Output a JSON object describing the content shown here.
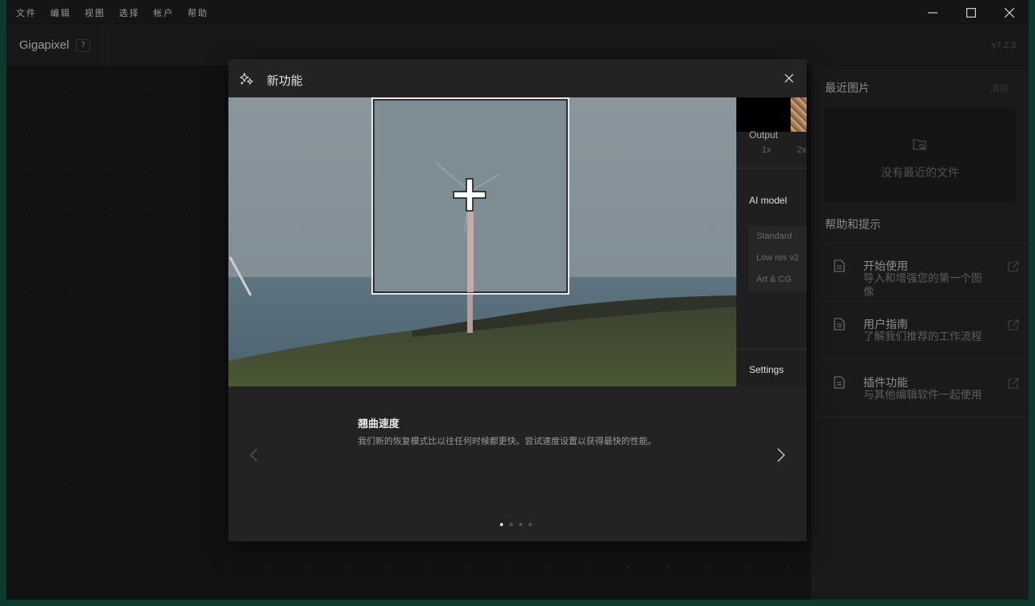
{
  "menubar": {
    "items": [
      "文件",
      "编辑",
      "视图",
      "选择",
      "帐户",
      "帮助"
    ]
  },
  "titlebar": {
    "app_name": "Gigapixel",
    "badge": "7",
    "version": "v7.2.3"
  },
  "right_panel": {
    "recent_heading": "最近图片",
    "clear_label": "清除",
    "recent_empty": "没有最近的文件",
    "help_heading": "帮助和提示",
    "help_items": [
      {
        "title": "开始使用",
        "desc": "导入和增强您的第一个图像"
      },
      {
        "title": "用户指南",
        "desc": "了解我们推荐的工作流程"
      },
      {
        "title": "插件功能",
        "desc": "与其他编辑软件一起使用"
      }
    ]
  },
  "modal": {
    "title": "新功能",
    "side": {
      "output_label": "Output",
      "output_options": [
        "1x",
        "2x"
      ],
      "ai_model_label": "AI model",
      "models": [
        "Standard",
        "Low res v2",
        "Art & CG"
      ],
      "settings_label": "Settings"
    },
    "feature_title": "翘曲速度",
    "feature_desc": "我们新的恢复模式比以往任何时候都更快。尝试速度设置以获得最快的性能。",
    "slides": {
      "count": 4,
      "active": 1
    }
  },
  "colors": {
    "background": "#0d3a2e",
    "app": "#111111",
    "modal": "#232323",
    "panel": "#1a1a1a"
  },
  "icons": [
    "minimize-icon",
    "maximize-icon",
    "close-icon",
    "sparkles-icon",
    "folder-search-icon",
    "document-icon",
    "external-link-icon",
    "crosshair-icon",
    "chevron-left-icon",
    "chevron-right-icon"
  ]
}
